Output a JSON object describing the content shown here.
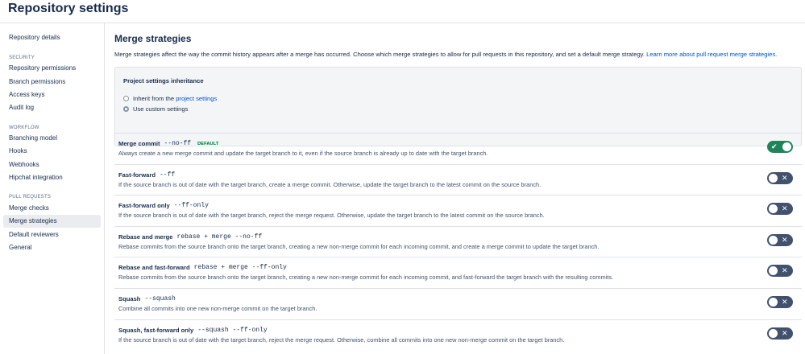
{
  "header": {
    "title": "Repository settings"
  },
  "sidebar": {
    "top_items": [
      {
        "label": "Repository details"
      }
    ],
    "security_heading": "SECURITY",
    "security_items": [
      {
        "label": "Repository permissions"
      },
      {
        "label": "Branch permissions"
      },
      {
        "label": "Access keys"
      },
      {
        "label": "Audit log"
      }
    ],
    "workflow_heading": "WORKFLOW",
    "workflow_items": [
      {
        "label": "Branching model"
      },
      {
        "label": "Hooks"
      },
      {
        "label": "Webhooks"
      },
      {
        "label": "Hipchat integration"
      }
    ],
    "pr_heading": "PULL REQUESTS",
    "pr_items": [
      {
        "label": "Merge checks"
      },
      {
        "label": "Merge strategies"
      },
      {
        "label": "Default reviewers"
      },
      {
        "label": "General"
      }
    ]
  },
  "main": {
    "title": "Merge strategies",
    "description": "Merge strategies affect the way the commit history appears after a merge has occurred. Choose which merge strategies to allow for pull requests in this repository, and set a default merge strategy.",
    "learn_more_link": "Learn more about pull request merge strategies.",
    "inheritance": {
      "heading": "Project settings inheritance",
      "option_inherit_prefix": "Inherit from the",
      "option_inherit_link": "project settings",
      "option_custom": "Use custom settings",
      "selected": "custom"
    },
    "strategies": [
      {
        "name": "Merge commit",
        "code": "--no-ff",
        "badge": "DEFAULT",
        "enabled": true,
        "description": "Always create a new merge commit and update the target branch to it, even if the source branch is already up to date with the target branch."
      },
      {
        "name": "Fast-forward",
        "code": "--ff",
        "badge": "",
        "enabled": false,
        "description": "If the source branch is out of date with the target branch, create a merge commit. Otherwise, update the target branch to the latest commit on the source branch."
      },
      {
        "name": "Fast-forward only",
        "code": "--ff-only",
        "badge": "",
        "enabled": false,
        "description": "If the source branch is out of date with the target branch, reject the merge request. Otherwise, update the target branch to the latest commit on the source branch."
      },
      {
        "name": "Rebase and merge",
        "code": "rebase + merge --no-ff",
        "badge": "",
        "enabled": false,
        "description": "Rebase commits from the source branch onto the target branch, creating a new non-merge commit for each incoming commit, and create a merge commit to update the target branch."
      },
      {
        "name": "Rebase and fast-forward",
        "code": "rebase + merge --ff-only",
        "badge": "",
        "enabled": false,
        "description": "Rebase commits from the source branch onto the target branch, creating a new non-merge commit for each incoming commit, and fast-forward the target branch with the resulting commits."
      },
      {
        "name": "Squash",
        "code": "--squash",
        "badge": "",
        "enabled": false,
        "description": "Combine all commits into one new non-merge commit on the target branch."
      },
      {
        "name": "Squash, fast-forward only",
        "code": "--squash --ff-only",
        "badge": "",
        "enabled": false,
        "description": "If the source branch is out of date with the target branch, reject the merge request. Otherwise, combine all commits into one new non-merge commit on the target branch."
      }
    ]
  },
  "colors": {
    "toggle_on": "#1f845a",
    "toggle_off": "#42526e",
    "link": "#0052cc",
    "badge_text": "#006644",
    "badge_bg": "#e3fcef"
  },
  "icons": {
    "toggle_on": "check-icon",
    "toggle_off": "close-icon"
  }
}
